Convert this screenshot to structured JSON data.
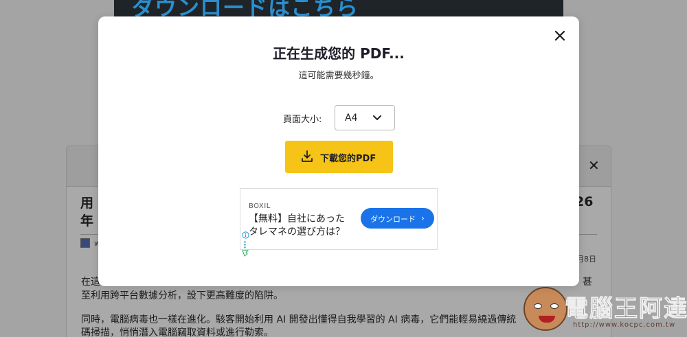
{
  "background": {
    "banner_text": "ダウンロードはこちら",
    "article_title_line1": "用",
    "article_title_line2": "年",
    "article_title_num": "26",
    "author_name": "w",
    "date_fragment": "月8日",
    "paragraphs": [
      "在這",
      "至利用跨平台數據分析，設下更高難度的陷阱。",
      "同時，電腦病毒也一樣在進化。駭客開始利用 AI 開發出懂得自我學習的 AI 病毒，它們能輕易繞過傳統",
      "碼掃描，悄悄潛入電腦竊取資料或進行勒索。"
    ],
    "paragraph_tail": "甚",
    "watermark_text": "電腦王阿達",
    "watermark_url": "http://www.kocpc.com.tw"
  },
  "modal": {
    "title": "正在生成您的 PDF...",
    "subtitle": "這可能需要幾秒鐘。",
    "page_size_label": "頁面大小:",
    "page_size_value": "A4",
    "download_label": "下載您的PDF"
  },
  "ad": {
    "brand": "BOXIL",
    "text_line1": "【無料】自社にあった",
    "text_line2": "タレマネの選び方は？",
    "button_label": "ダウンロード"
  },
  "colors": {
    "accent_yellow": "#f6c417",
    "ad_button_blue": "#1a73e8",
    "overlay_gray": "#a4a4a4"
  },
  "icons": {
    "modal_close": "close-icon",
    "select_chevron": "chevron-down-icon",
    "download": "download-icon",
    "ad_chevron": "chevron-right-icon",
    "ad_info": "info-icon",
    "ad_menu": "vertical-dots-icon",
    "ad_flag": "adchoices-icon"
  }
}
